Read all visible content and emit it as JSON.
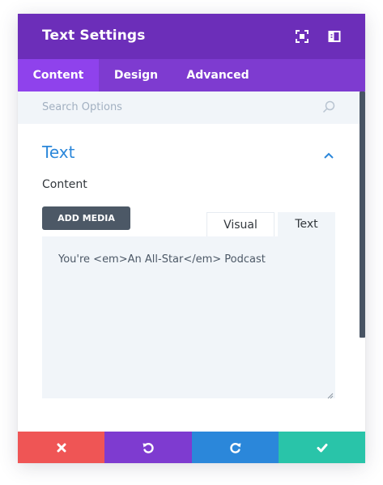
{
  "header": {
    "title": "Text Settings"
  },
  "tabs": [
    {
      "label": "Content"
    },
    {
      "label": "Design"
    },
    {
      "label": "Advanced"
    }
  ],
  "search": {
    "placeholder": "Search Options"
  },
  "section": {
    "title": "Text"
  },
  "content": {
    "label": "Content",
    "add_media_label": "ADD MEDIA",
    "editor_tabs": [
      "Visual",
      "Text"
    ],
    "editor_value": "You're <em>An All-Star</em> Podcast"
  },
  "footer": {
    "icons": [
      "close-icon",
      "undo-icon",
      "redo-icon",
      "check-icon"
    ]
  },
  "colors": {
    "header": "#6c2eb9",
    "tabs": "#7e3bd0",
    "active_tab": "#8f42ec",
    "section_title": "#2b87da",
    "discard": "#ef5555",
    "undo": "#7e3bd0",
    "redo": "#2b87da",
    "save": "#29c4a9"
  }
}
